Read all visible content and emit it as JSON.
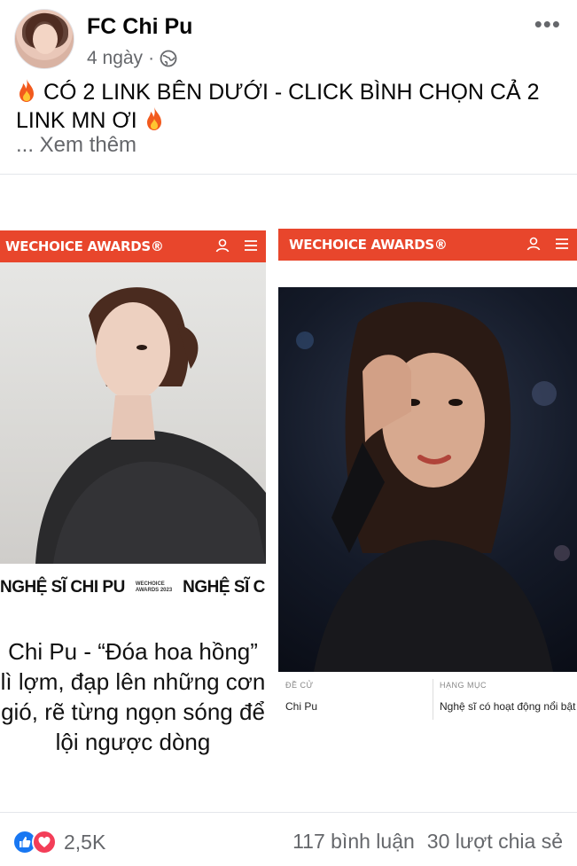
{
  "post": {
    "page_name": "FC Chi Pu",
    "time": "4 ngày",
    "dot": "·",
    "caption": "CÓ 2 LINK BÊN DƯỚI - CLICK BÌNH CHỌN CẢ 2 LINK MN ƠI",
    "see_more": "... Xem thêm",
    "more_label": "•••"
  },
  "card_left": {
    "brand": "WECHOICE AWARDS®",
    "ribbon_1": "NGHỆ SĨ CHI PU",
    "ribbon_mini_1": "WECHOICE",
    "ribbon_mini_2": "AWARDS 2023",
    "ribbon_2": "NGHỆ SĨ CI",
    "title": "Chi Pu - “Đóa hoa hồng” lì lợm, đạp lên những cơn gió, rẽ từng ngọn sóng để lội ngược dòng"
  },
  "card_right": {
    "brand": "WECHOICE AWARDS®",
    "nominee_label": "ĐỀ CỬ",
    "nominee_value": "Chi Pu",
    "category_label": "HẠNG MỤC",
    "category_value": "Nghệ sĩ có hoạt động nổi bật"
  },
  "footer": {
    "reaction_count": "2,5K",
    "comments": "117 bình luận",
    "shares": "30 lượt chia sẻ"
  },
  "colors": {
    "brand_red": "#e8462c",
    "like_blue": "#1877f2",
    "love_red": "#f33e58",
    "muted": "#65676b"
  },
  "icons": [
    "globe-icon",
    "fire-icon",
    "user-icon",
    "menu-icon",
    "like-icon",
    "love-icon",
    "more-icon"
  ]
}
